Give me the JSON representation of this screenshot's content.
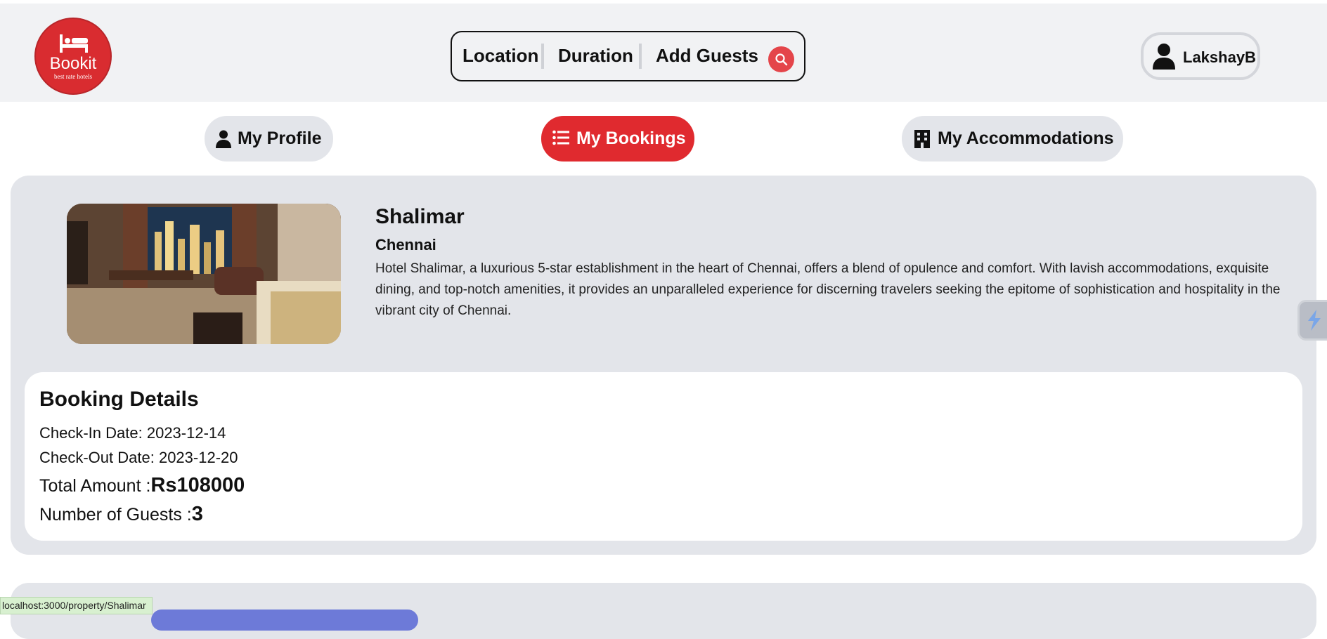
{
  "header": {
    "logo_name": "Bookit",
    "logo_tagline": "best rate hotels",
    "search": {
      "location_label": "Location",
      "duration_label": "Duration",
      "guests_label": "Add Guests"
    },
    "user_name": "LakshayB"
  },
  "tabs": [
    {
      "label": "My Profile",
      "icon": "user-icon",
      "active": false
    },
    {
      "label": "My Bookings",
      "icon": "list-icon",
      "active": true
    },
    {
      "label": "My Accommodations",
      "icon": "building-icon",
      "active": false
    }
  ],
  "booking": {
    "hotel_name": "Shalimar",
    "city": "Chennai",
    "description": "Hotel Shalimar, a luxurious 5-star establishment in the heart of Chennai, offers a blend of opulence and comfort. With lavish accommodations, exquisite dining, and top-notch amenities, it provides an unparalleled experience for discerning travelers seeking the epitome of sophistication and hospitality in the vibrant city of Chennai.",
    "details_title": "Booking Details",
    "checkin_label": "Check-In Date: ",
    "checkin": "2023-12-14",
    "checkout_label": "Check-Out Date: ",
    "checkout": "2023-12-20",
    "total_label": "Total Amount :",
    "total": "Rs108000",
    "guests_label": "Number of Guests :",
    "guests": "3"
  },
  "status_bar": "localhost:3000/property/Shalimar",
  "colors": {
    "brand_red": "#e02a2f",
    "card_bg": "#e3e5ea",
    "header_bg": "#f1f2f4"
  }
}
